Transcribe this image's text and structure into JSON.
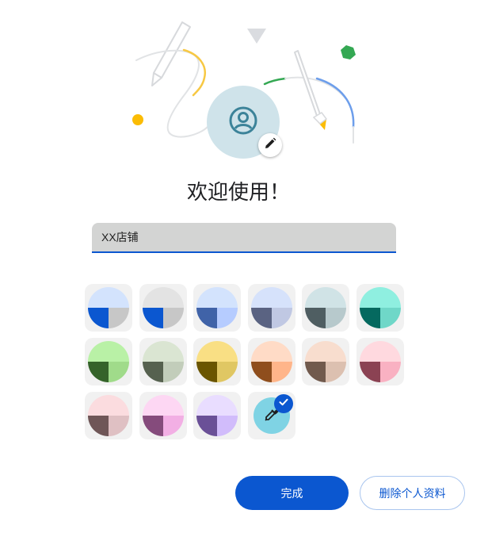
{
  "header": {
    "title": "欢迎使用！"
  },
  "profile_name": {
    "value": "XX店铺"
  },
  "colors": {
    "accent": "#0b57d0",
    "avatar_bg": "#cfe3ea",
    "avatar_icon": "#3c8399",
    "custom_swatch": "#7fd3e4"
  },
  "icons": {
    "avatar": "person-circle-icon",
    "edit": "pencil-icon",
    "custom": "eyedropper-icon",
    "selected": "checkmark-icon"
  },
  "themes": [
    {
      "name": "theme-1",
      "top": "#d3e3fd",
      "left": "#0b57d0",
      "right": "#c7c7c7"
    },
    {
      "name": "theme-2",
      "top": "#e3e3e3",
      "left": "#0b57d0",
      "right": "#c7c7c7"
    },
    {
      "name": "theme-3",
      "top": "#d3e3fd",
      "left": "#4063a8",
      "right": "#b6ccff"
    },
    {
      "name": "theme-4",
      "top": "#d6e2fb",
      "left": "#5a6382",
      "right": "#c0c8e3"
    },
    {
      "name": "theme-5",
      "top": "#d0e3e6",
      "left": "#4f5e62",
      "right": "#b7c9cc"
    },
    {
      "name": "theme-6",
      "top": "#8fefe0",
      "left": "#05695f",
      "right": "#6fd7c8"
    },
    {
      "name": "theme-7",
      "top": "#b9f1a6",
      "left": "#35632a",
      "right": "#a0db8a"
    },
    {
      "name": "theme-8",
      "top": "#dae5d2",
      "left": "#56614f",
      "right": "#c2cdba"
    },
    {
      "name": "theme-9",
      "top": "#f9df84",
      "left": "#6a5500",
      "right": "#e0c763"
    },
    {
      "name": "theme-10",
      "top": "#ffdbc6",
      "left": "#8f4e1d",
      "right": "#ffb58a"
    },
    {
      "name": "theme-11",
      "top": "#f8ddce",
      "left": "#715a4d",
      "right": "#dcc0b0"
    },
    {
      "name": "theme-12",
      "top": "#ffd9df",
      "left": "#8b4253",
      "right": "#f9b1c2"
    },
    {
      "name": "theme-13",
      "top": "#fbdcdf",
      "left": "#6f5657",
      "right": "#dfc0c3"
    },
    {
      "name": "theme-14",
      "top": "#fdd7f3",
      "left": "#854b7c",
      "right": "#f2afe4"
    },
    {
      "name": "theme-15",
      "top": "#e9ddff",
      "left": "#6a5097",
      "right": "#d1bcfb"
    }
  ],
  "actions": {
    "done_label": "完成",
    "delete_label": "删除个人资料"
  }
}
